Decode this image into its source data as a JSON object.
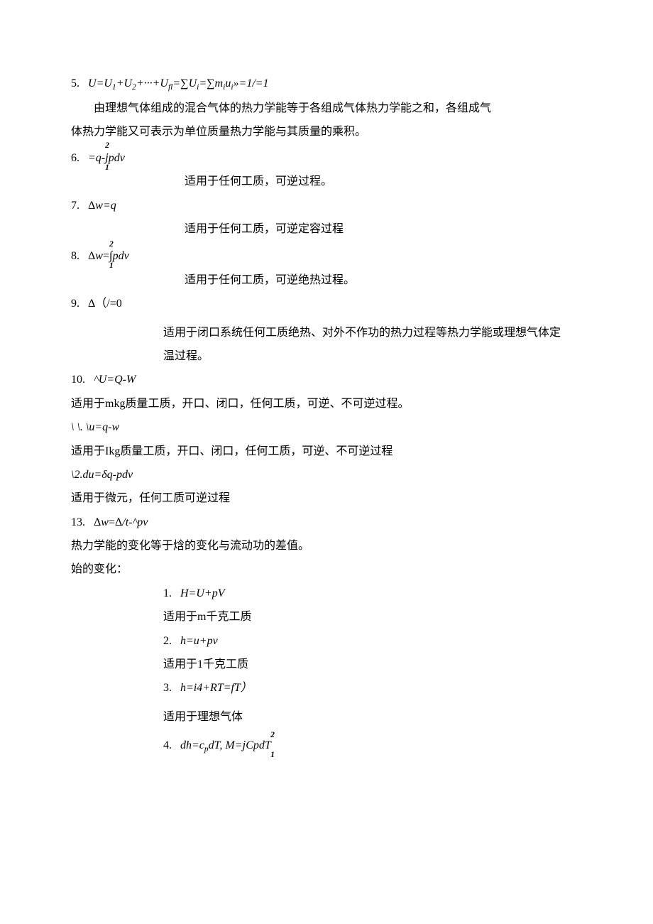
{
  "lines": {
    "l5_num": "5.",
    "l5_eq": "U=U₁+U₂+···+Uₙ=∑Uᵢ=∑mᵢuᵢ »=1/=1",
    "l5_expA": "由理想气体组成的混合气体的热力学能等于各组成气体热力学能之和，各组成气",
    "l5_expB": "体热力学能又可表示为单位质量热力学能与其质量的乘积。",
    "l6_num": "6.",
    "l6_eq_pre": "=q-",
    "l6_eq_post": "pdv",
    "l6_exp": "适用于任何工质，可逆过程。",
    "l7_num": "7.",
    "l7_eq": "Δw=q",
    "l7_exp": "适用于任何工质，可逆定容过程",
    "l8_num": "8.",
    "l8_eq_pre": "Δw=",
    "l8_eq_post": "pdv",
    "l8_exp": "适用于任何工质，可逆绝热过程。",
    "l9_num": "9.",
    "l9_eq": "Δ（/=0",
    "l9_expA": "适用于闭口系统任何工质绝热、对外不作功的热力过程等热力学能或理想气体定",
    "l9_expB": "温过程。",
    "l10_num": "10.",
    "l10_eq": "^U=Q-W",
    "l10_exp": "适用于mkg质量工质，开口、闭口，任何工质，可逆、不可逆过程。",
    "l11_num": "\\ \\ .",
    "l11_eq": "\\u=q-w",
    "l11_exp": "适用于Ikg质量工质，开口、闭口，任何工质，可逆、不可逆过程",
    "l12_num": "\\2.",
    "l12_eq": "du=δq-pdv",
    "l12_exp": "适用于微元，任何工质可逆过程",
    "l13_num": "13.",
    "l13_eq": "Δw=Δ/t-^pv",
    "l13_exp": "热力学能的变化等于焓的变化与流动功的差值。",
    "sec_h": "始的变化：",
    "h1_num": "1.",
    "h1_eq": "H=U+pV",
    "h1_exp": "适用于m千克工质",
    "h2_num": "2.",
    "h2_eq": "h=u+pv",
    "h2_exp": "适用于1千克工质",
    "h3_num": "3.",
    "h3_eq": "h=i4+RT=fT）",
    "h3_exp": "适用于理想气体",
    "h4_num": "4.",
    "h4_eq_a": "dh=c",
    "h4_eq_b": "dT, M=",
    "h4_eq_c": "CpdT",
    "int_up": "2",
    "int_lo": "1",
    "int_sym_j": "j",
    "int_sym_int": "∫"
  }
}
